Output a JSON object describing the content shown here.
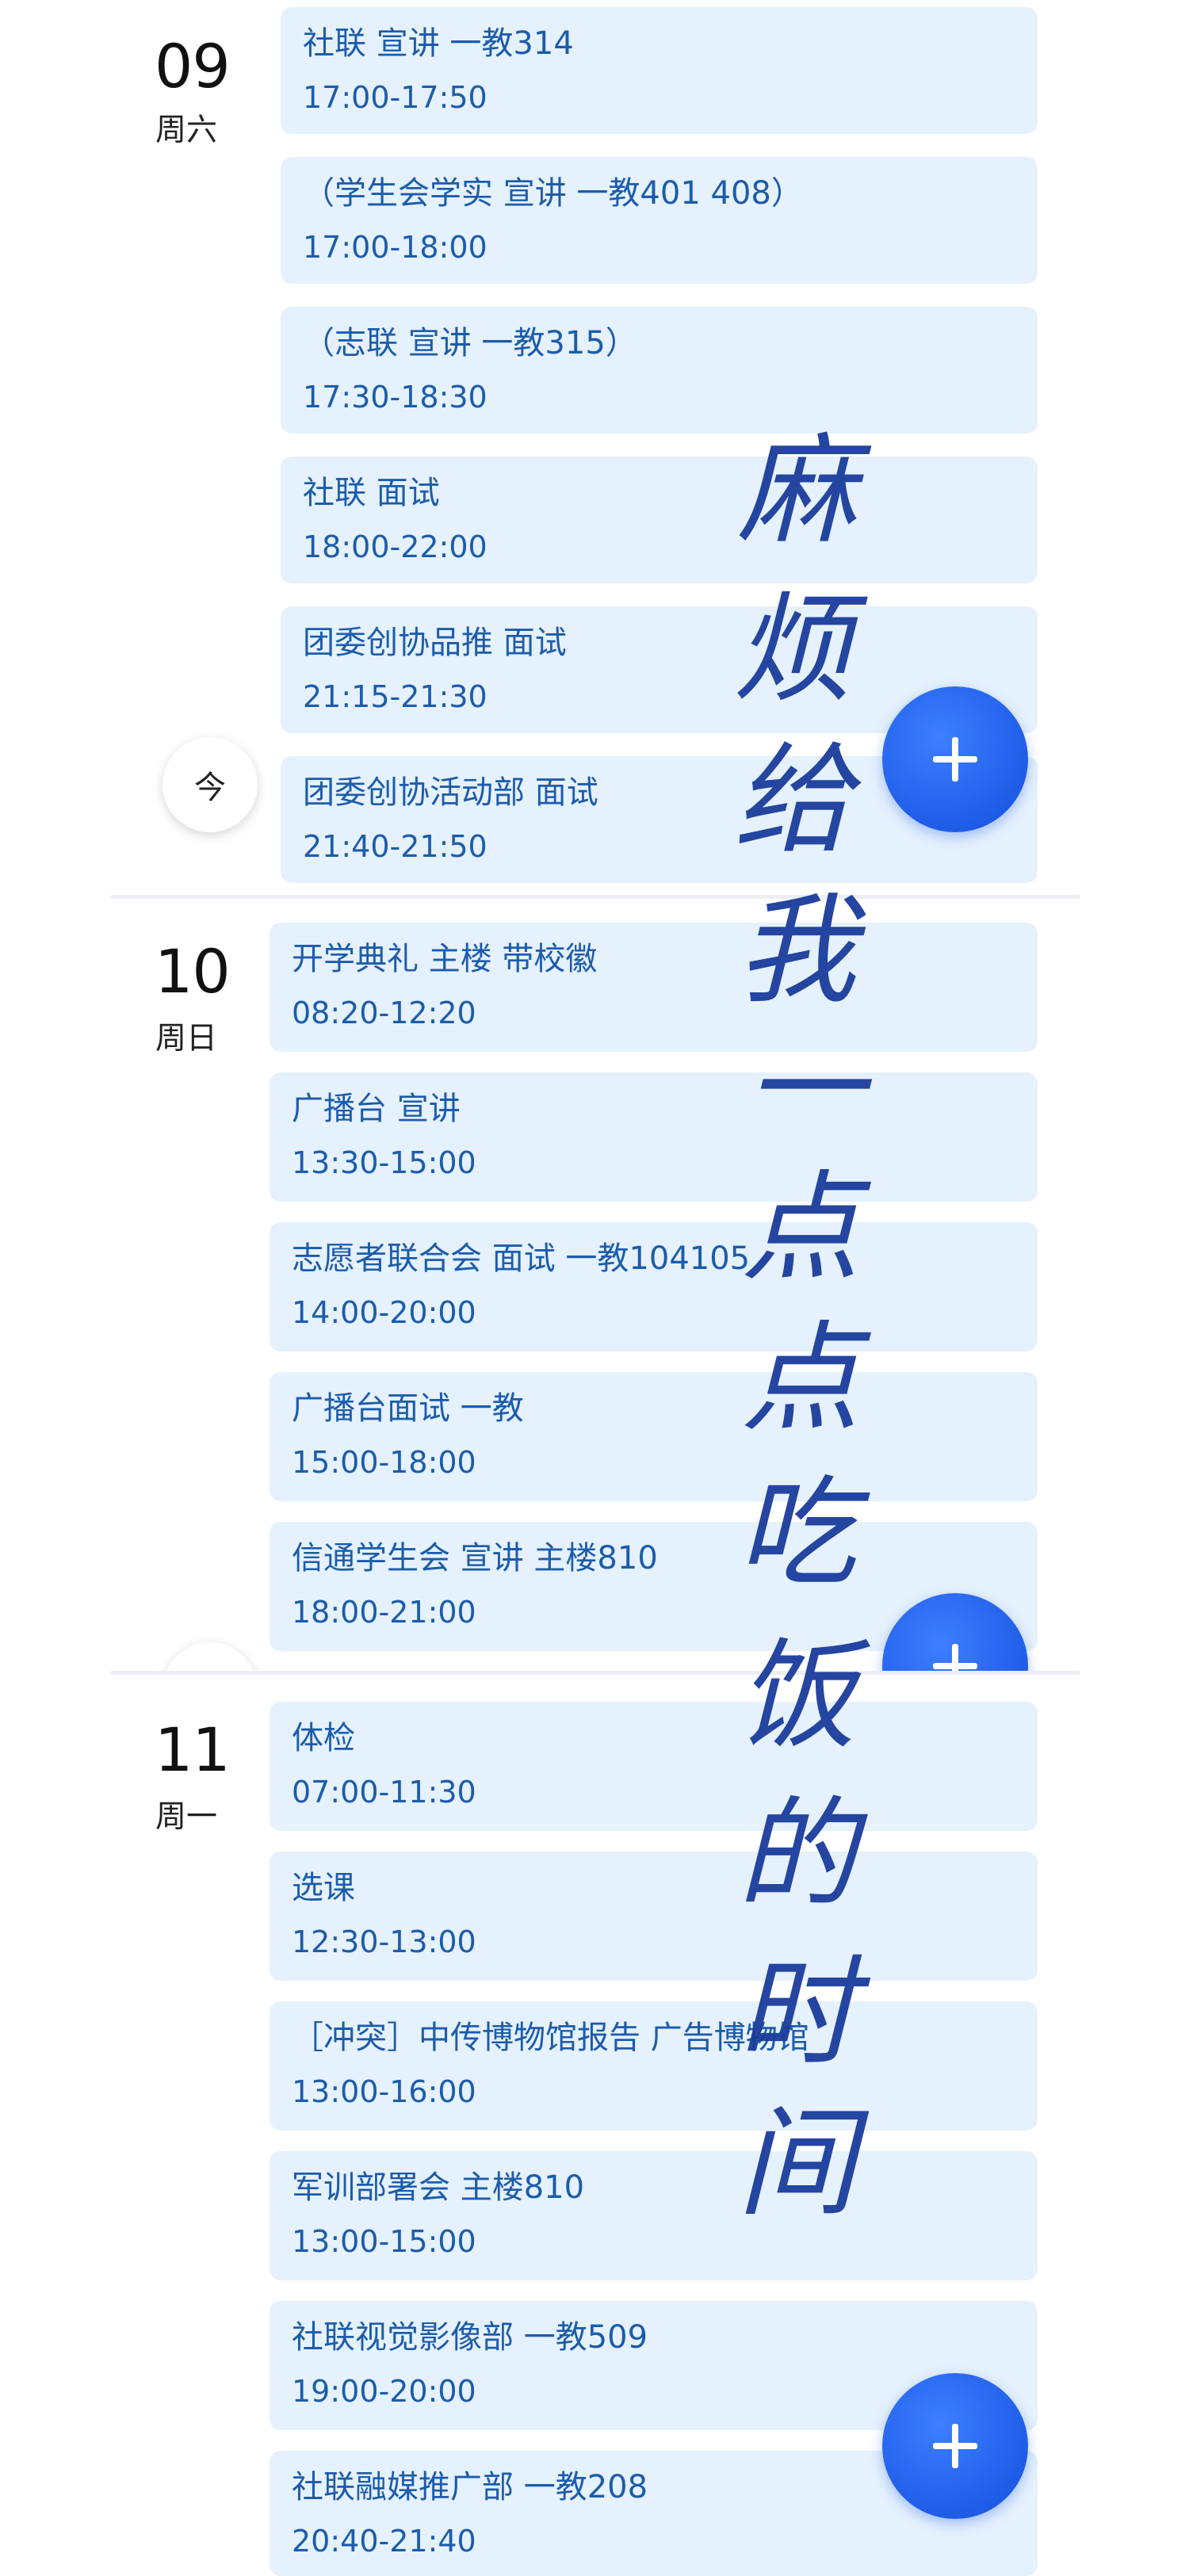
{
  "days": [
    {
      "number": "09",
      "weekday": "周六",
      "events": [
        {
          "title": "社联 宣讲 一教314",
          "time": "17:00-17:50"
        },
        {
          "title": "（学生会学实 宣讲 一教401 408）",
          "time": "17:00-18:00"
        },
        {
          "title": "（志联 宣讲 一教315）",
          "time": "17:30-18:30"
        },
        {
          "title": "社联 面试",
          "time": "18:00-22:00"
        },
        {
          "title": "团委创协品推 面试",
          "time": "21:15-21:30"
        },
        {
          "title": "团委创协活动部 面试",
          "time": "21:40-21:50"
        }
      ]
    },
    {
      "number": "10",
      "weekday": "周日",
      "events": [
        {
          "title": "开学典礼 主楼 带校徽",
          "time": "08:20-12:20"
        },
        {
          "title": "广播台 宣讲",
          "time": "13:30-15:00"
        },
        {
          "title": "志愿者联合会 面试 一教104105",
          "time": "14:00-20:00"
        },
        {
          "title": "广播台面试 一教",
          "time": "15:00-18:00"
        },
        {
          "title": "信通学生会 宣讲 主楼810",
          "time": "18:00-21:00"
        }
      ]
    },
    {
      "number": "11",
      "weekday": "周一",
      "events": [
        {
          "title": "体检",
          "time": "07:00-11:30"
        },
        {
          "title": "选课",
          "time": "12:30-13:00"
        },
        {
          "title": "［冲突］中传博物馆报告 广告博物馆",
          "time": "13:00-16:00"
        },
        {
          "title": "军训部署会 主楼810",
          "time": "13:00-15:00"
        },
        {
          "title": "社联视觉影像部 一教509",
          "time": "19:00-20:00"
        },
        {
          "title": "社联融媒推广部 一教208",
          "time": "20:40-21:40"
        }
      ]
    }
  ],
  "today_button": "今",
  "handwriting": [
    "麻",
    "烦",
    "给",
    "我",
    "一",
    "点",
    "点",
    "吃",
    "饭",
    "的",
    "时",
    "间"
  ],
  "colors": {
    "event_bg": "#e5f1fc",
    "event_text": "#1c5cab",
    "fab": "#1f5de8",
    "handwriting": "#1a3c9c"
  },
  "icons": {
    "fab": "plus-icon"
  }
}
